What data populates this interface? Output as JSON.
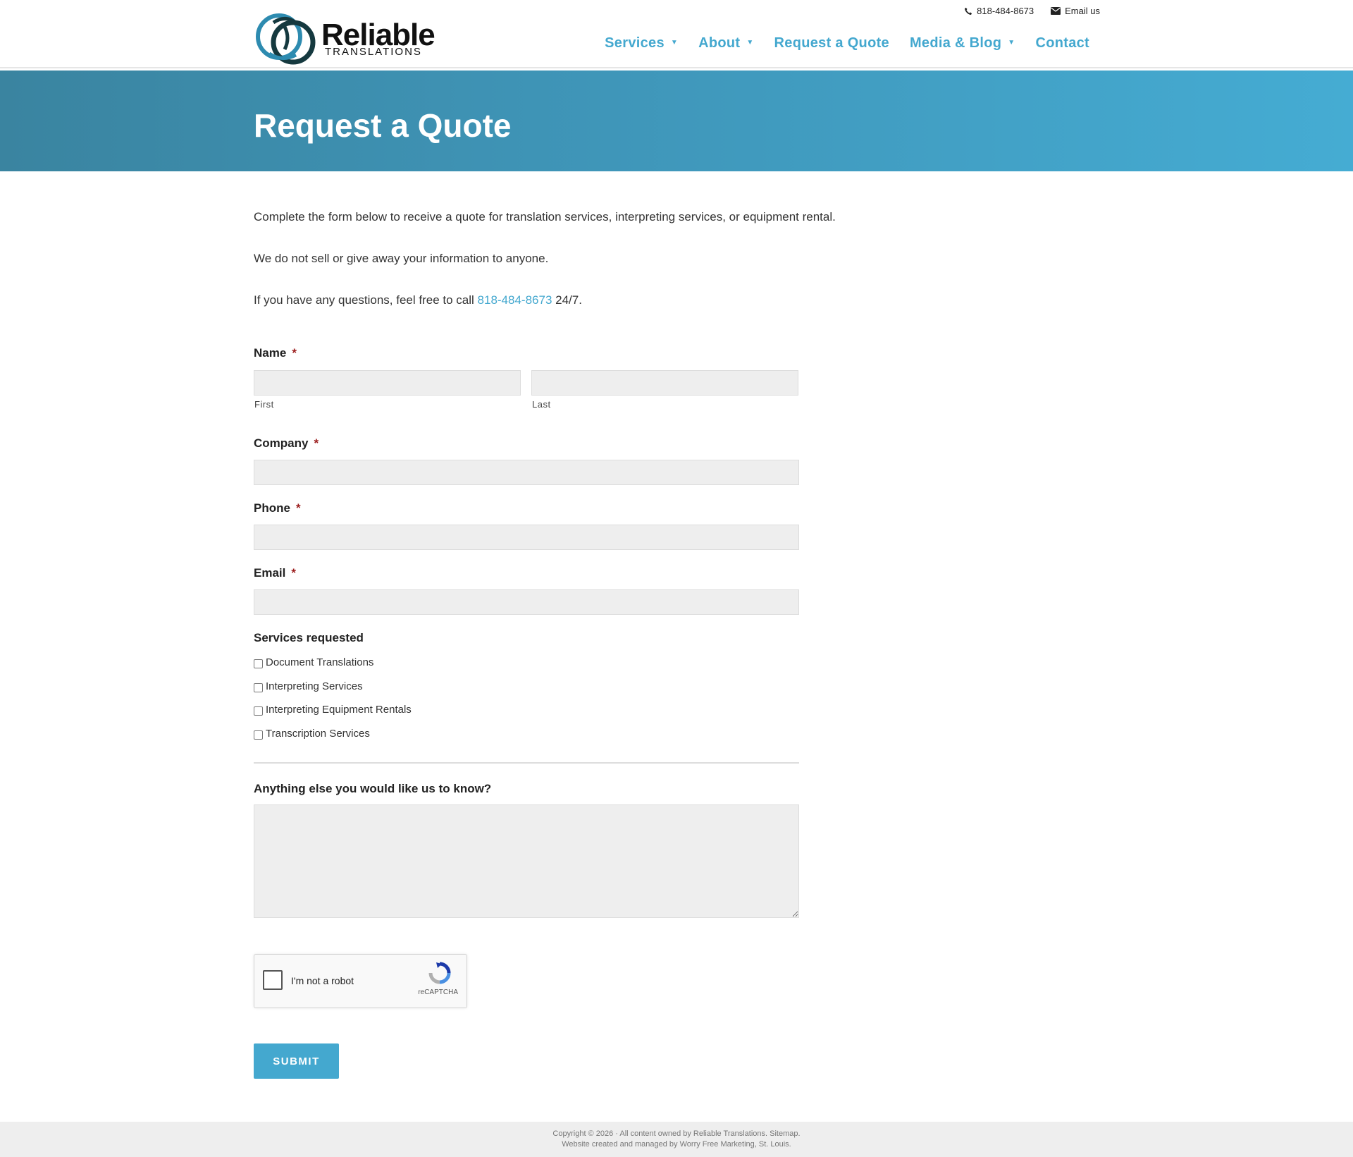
{
  "brand": {
    "logo_word": "Reliable",
    "logo_sub": "TRANSLATIONS"
  },
  "utility": {
    "phone_label": "818-484-8673",
    "phone_icon": "phone-icon",
    "email_label": "Email us",
    "email_icon": "envelope-icon"
  },
  "nav": {
    "items": [
      {
        "label": "Services",
        "has_dropdown": true
      },
      {
        "label": "About",
        "has_dropdown": true
      },
      {
        "label": "Request a Quote",
        "has_dropdown": false
      },
      {
        "label": "Media & Blog",
        "has_dropdown": true
      },
      {
        "label": "Contact",
        "has_dropdown": false
      }
    ],
    "caret": "▼"
  },
  "banner": {
    "title": "Request a Quote"
  },
  "intro": {
    "line1": "Complete the form below to receive a quote for translation services, interpreting services, or equipment rental.",
    "line2": "We do not sell or give away your information to anyone.",
    "line3_before": "If you have any questions, feel free to call ",
    "line3_link": "818-484-8673",
    "line3_after": " 24/7."
  },
  "form": {
    "required_mark": "*",
    "name_label": "Name",
    "first_sublabel": "First",
    "last_sublabel": "Last",
    "first_value": "",
    "last_value": "",
    "company_label": "Company",
    "company_value": "",
    "phone_label": "Phone",
    "phone_value": "",
    "email_label": "Email",
    "email_value": "",
    "services_label": "Services requested",
    "services": [
      {
        "label": "Document Translations",
        "checked": false
      },
      {
        "label": "Interpreting Services",
        "checked": false
      },
      {
        "label": "Interpreting Equipment Rentals",
        "checked": false
      },
      {
        "label": "Transcription Services",
        "checked": false
      }
    ],
    "notes_label": "Anything else you would like us to know?",
    "notes_value": "",
    "recaptcha_text": "I'm not a robot",
    "recaptcha_brand": "reCAPTCHA",
    "submit_label": "SUBMIT"
  },
  "colors": {
    "accent": "#44a8cf",
    "banner_start": "#3a84a0",
    "banner_end": "#45acd3",
    "required": "#9b1c1c",
    "input_bg": "#eeeeee"
  },
  "footer": {
    "line1_before": "Copyright © 2026 · All content owned by Reliable Translations. ",
    "line1_link": "Sitemap",
    "line1_after": ".",
    "line2_before": "Website created and managed by ",
    "line2_link": "Worry Free Marketing",
    "line2_after": ", St. Louis."
  }
}
